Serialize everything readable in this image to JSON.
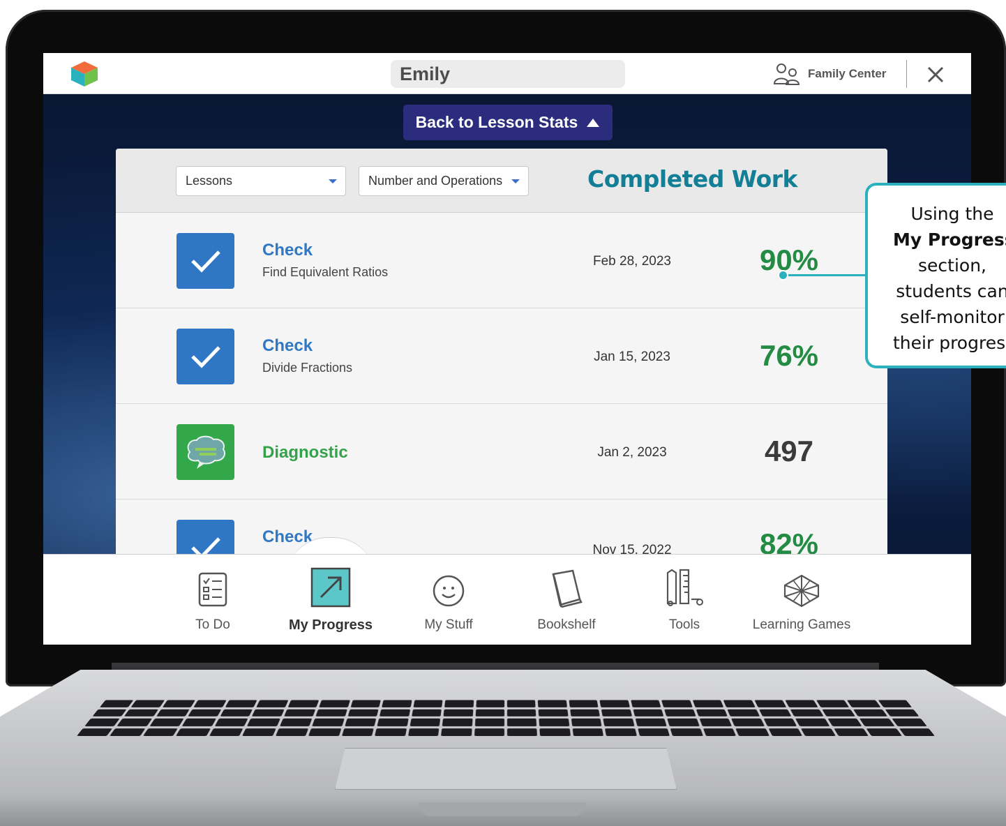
{
  "header": {
    "student_name": "Emily",
    "family_center_label": "Family Center"
  },
  "back_button": {
    "label": "Back to Lesson Stats"
  },
  "filters": {
    "type_select": "Lessons",
    "domain_select": "Number and Operations"
  },
  "panel_title": "Completed Work",
  "rows": [
    {
      "kind": "check",
      "title": "Check",
      "subtitle": "Find Equivalent Ratios",
      "date": "Feb 28, 2023",
      "score": "90%"
    },
    {
      "kind": "check",
      "title": "Check",
      "subtitle": "Divide Fractions",
      "date": "Jan 15, 2023",
      "score": "76%"
    },
    {
      "kind": "diagnostic",
      "title": "Diagnostic",
      "subtitle": "",
      "date": "Jan 2, 2023",
      "score": "497"
    },
    {
      "kind": "check",
      "title": "Check",
      "subtitle": "",
      "date": "Nov 15, 2022",
      "score": "82%"
    }
  ],
  "nav": {
    "items": [
      {
        "label": "To Do",
        "icon": "checklist-icon"
      },
      {
        "label": "My Progress",
        "icon": "progress-arrow-icon",
        "active": true
      },
      {
        "label": "My Stuff",
        "icon": "smiley-icon"
      },
      {
        "label": "Bookshelf",
        "icon": "book-icon"
      },
      {
        "label": "Tools",
        "icon": "tools-icon"
      },
      {
        "label": "Learning Games",
        "icon": "games-icon"
      }
    ]
  },
  "callout": {
    "line1": "Using the",
    "line2": "My Progress",
    "line3": "section,",
    "line4": "students can",
    "line5": "self-monitor",
    "line6": "their progress"
  },
  "colors": {
    "accent_navy": "#2b2c7d",
    "title_teal": "#127f96",
    "check_blue": "#2f77c4",
    "diagnostic_green": "#33a84b",
    "score_green": "#238b43",
    "callout_teal": "#2bb1bd"
  }
}
